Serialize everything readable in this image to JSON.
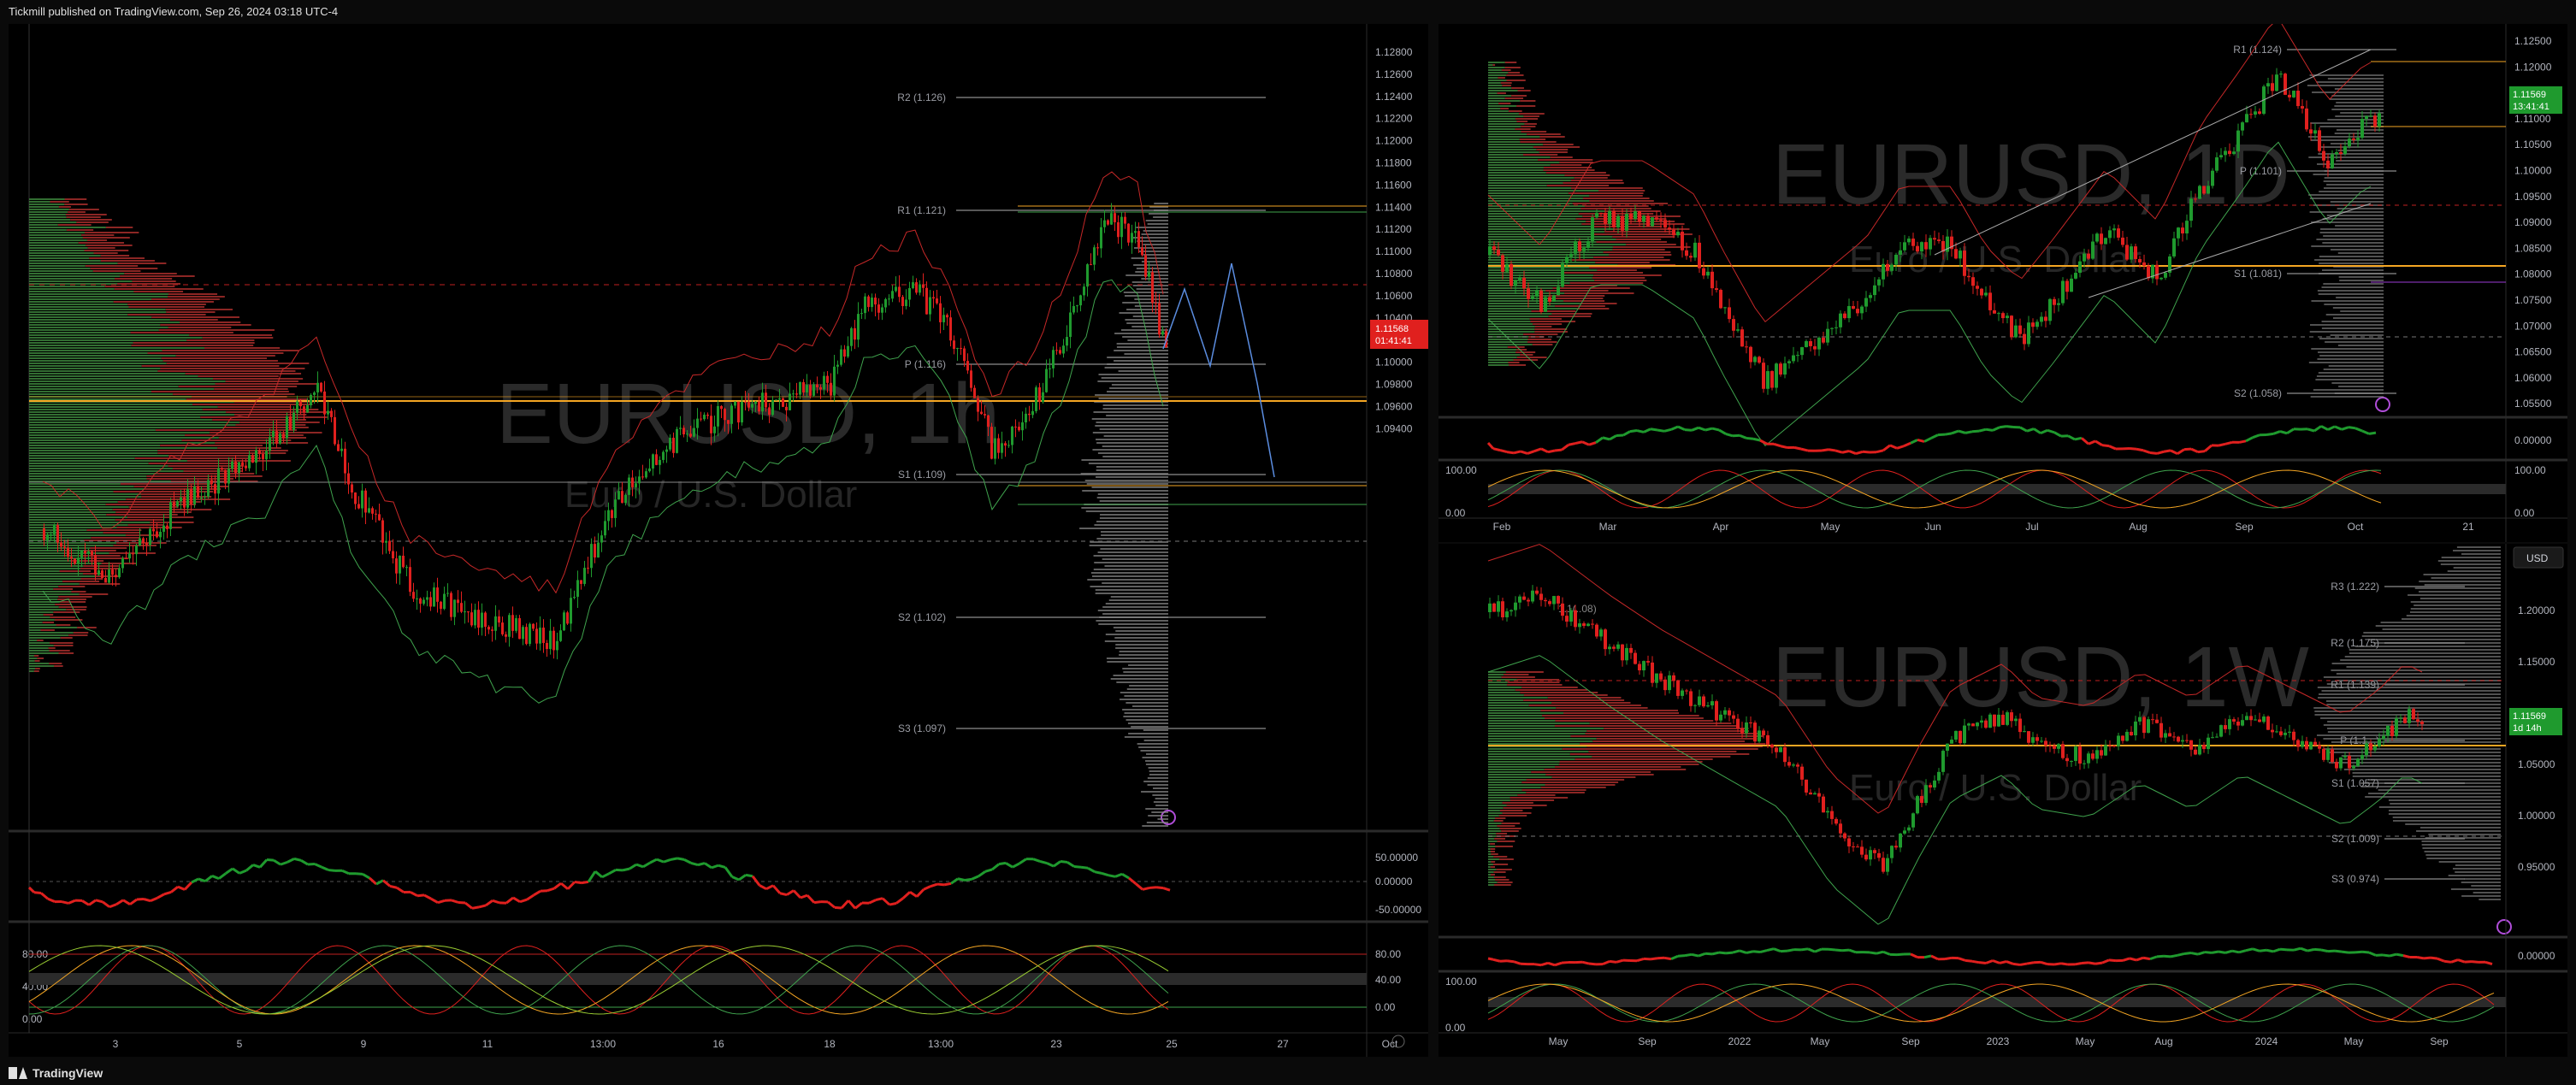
{
  "header": {
    "publish_text": "Tickmill published on TradingView.com, Sep 26, 2024 03:18 UTC-4"
  },
  "footer": {
    "brand": "TradingView"
  },
  "colors": {
    "up": "#1f9a2e",
    "down": "#e0201e",
    "poc": "#f5a623",
    "background": "#000000",
    "text": "#b2b5be"
  },
  "left_chart": {
    "watermark_symbol": "EURUSD, 1h",
    "watermark_desc": "Euro / U.S. Dollar",
    "price_axis": [
      "1.12800",
      "1.12600",
      "1.12400",
      "1.12200",
      "1.12000",
      "1.11800",
      "1.11600",
      "1.11400",
      "1.11200",
      "1.11000",
      "1.10800",
      "1.10600",
      "1.10400",
      "1.10200",
      "1.10000",
      "1.09800",
      "1.09600",
      "1.09400"
    ],
    "price_badge": "1.11568",
    "price_badge_timer": "01:41:41",
    "pivots": [
      "R2 (1.126)",
      "R1 (1.121)",
      "P (1.116)",
      "S1 (1.109)",
      "S2 (1.102)",
      "S3 (1.097)"
    ],
    "time_axis": [
      "3",
      "5",
      "9",
      "11",
      "13:00",
      "16",
      "18",
      "13:00",
      "23",
      "25",
      "27",
      "Oct"
    ],
    "osc1_axis": [
      "50.00000",
      "0.00000",
      "-50.00000"
    ],
    "osc2_axis": [
      "80.00",
      "40.00",
      "0.00"
    ],
    "osc2_left_axis": [
      "80.00",
      "40.00",
      "0.00"
    ]
  },
  "daily_chart": {
    "watermark_symbol": "EURUSD, 1D",
    "watermark_desc": "Euro / U.S. Dollar",
    "price_axis": [
      "1.12500",
      "1.12000",
      "1.11500",
      "1.11000",
      "1.10500",
      "1.10000",
      "1.09500",
      "1.09000",
      "1.08500",
      "1.08000",
      "1.07500",
      "1.07000",
      "1.06500",
      "1.06000",
      "1.05500"
    ],
    "price_badge": "1.11569",
    "price_badge_timer": "13:41:41",
    "pivots": [
      "R1 (1.124)",
      "P (1.101)",
      "S1 (1.081)",
      "S2 (1.058)"
    ],
    "time_axis": [
      "Feb",
      "Mar",
      "Apr",
      "May",
      "Jun",
      "Jul",
      "Aug",
      "Sep",
      "Oct",
      "21"
    ],
    "osc1_axis": [
      "0.00000"
    ],
    "osc2_axis": [
      "100.00",
      "0.00"
    ],
    "osc2_right_axis": [
      "100.00",
      "0.00"
    ]
  },
  "weekly_chart": {
    "watermark_symbol": "EURUSD, 1W",
    "watermark_desc": "Euro / U.S. Dollar",
    "currency_button": "USD",
    "price_axis": [
      "1.20000",
      "1.15000",
      "1.10000",
      "1.05000",
      "1.00000",
      "0.95000"
    ],
    "price_badge": "1.11569",
    "price_badge_timer": "1d 14h",
    "pivots": [
      "R3 (1.222)",
      "R2 (1.175)",
      "R1 (1.139)",
      "P (1.1...)",
      "S1 (1.057)",
      "S2 (1.009)",
      "S3 (0.974)"
    ],
    "extra_label": "1.1(..08)",
    "time_axis": [
      "May",
      "Sep",
      "2022",
      "May",
      "Sep",
      "2023",
      "May",
      "Aug",
      "2024",
      "May",
      "Sep"
    ],
    "osc1_axis": [
      "0.00000"
    ],
    "osc2_axis": [
      "100.00",
      "0.00"
    ]
  }
}
